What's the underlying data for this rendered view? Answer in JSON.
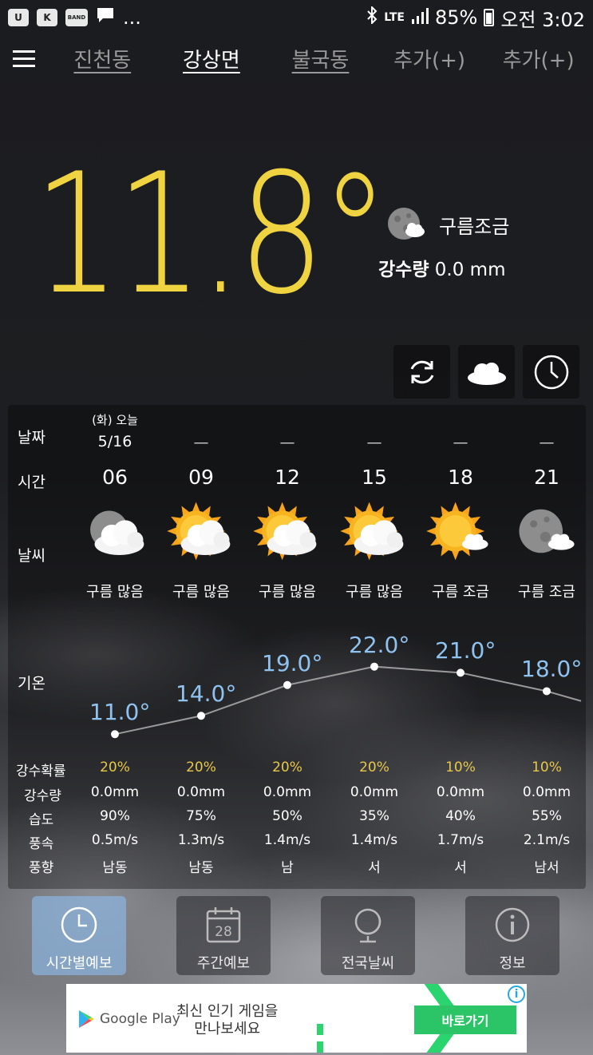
{
  "status_bar": {
    "left_icons": [
      "U",
      "K",
      "BAND",
      "chat",
      "..."
    ],
    "network": "LTE",
    "battery": "85%",
    "time": "오전 3:02"
  },
  "tabs": [
    {
      "label": "진천동"
    },
    {
      "label": "강상면"
    },
    {
      "label": "불국동"
    },
    {
      "label": "추가(+)"
    },
    {
      "label": "추가(+)"
    }
  ],
  "current": {
    "temperature": "11.8°",
    "condition": "구름조금",
    "precip_label": "강수량",
    "precip_value": "0.0 mm"
  },
  "row_labels": {
    "date": "날짜",
    "time": "시간",
    "weather": "날씨",
    "temp": "기온",
    "pop": "강수확률",
    "precip": "강수량",
    "humidity": "습도",
    "wind_speed": "풍속",
    "wind_dir": "풍향"
  },
  "date_today": {
    "day": "(화) 오늘",
    "date": "5/16"
  },
  "date_dash": "—",
  "forecast": [
    {
      "hour": "06",
      "icon": "moon-cloud-heavy",
      "cond": "구름 많음",
      "temp": 11.0,
      "temp_label": "11.0°",
      "pop": "20%",
      "precip": "0.0mm",
      "humidity": "90%",
      "wind": "0.5m/s",
      "dir": "남동"
    },
    {
      "hour": "09",
      "icon": "sun-cloud-heavy",
      "cond": "구름 많음",
      "temp": 14.0,
      "temp_label": "14.0°",
      "pop": "20%",
      "precip": "0.0mm",
      "humidity": "75%",
      "wind": "1.3m/s",
      "dir": "남동"
    },
    {
      "hour": "12",
      "icon": "sun-cloud-heavy",
      "cond": "구름 많음",
      "temp": 19.0,
      "temp_label": "19.0°",
      "pop": "20%",
      "precip": "0.0mm",
      "humidity": "50%",
      "wind": "1.4m/s",
      "dir": "남"
    },
    {
      "hour": "15",
      "icon": "sun-cloud-heavy",
      "cond": "구름 많음",
      "temp": 22.0,
      "temp_label": "22.0°",
      "pop": "20%",
      "precip": "0.0mm",
      "humidity": "35%",
      "wind": "1.4m/s",
      "dir": "서"
    },
    {
      "hour": "18",
      "icon": "sun-cloud-light",
      "cond": "구름 조금",
      "temp": 21.0,
      "temp_label": "21.0°",
      "pop": "10%",
      "precip": "0.0mm",
      "humidity": "40%",
      "wind": "1.7m/s",
      "dir": "서"
    },
    {
      "hour": "21",
      "icon": "moon-cloud-light",
      "cond": "구름 조금",
      "temp": 18.0,
      "temp_label": "18.0°",
      "pop": "10%",
      "precip": "0.0mm",
      "humidity": "55%",
      "wind": "2.1m/s",
      "dir": "남서"
    }
  ],
  "bottom_nav": [
    {
      "label": "시간별예보",
      "icon": "clock-icon",
      "active": true
    },
    {
      "label": "주간예보",
      "icon": "calendar-icon",
      "cal_day": "28",
      "active": false
    },
    {
      "label": "전국날씨",
      "icon": "globe-icon",
      "active": false
    },
    {
      "label": "정보",
      "icon": "info-icon",
      "active": false
    }
  ],
  "ad": {
    "brand": "Google Play",
    "line1": "최신 인기 게임을",
    "line2": "만나보세요",
    "cta": "바로가기",
    "info": "i"
  },
  "colors": {
    "temp_yellow": "#f0d340",
    "temp_blue": "#8fc2ee",
    "pop_yellow": "#e8c84a",
    "active_nav": "#8cb9e6",
    "ad_green": "#2bc466"
  }
}
